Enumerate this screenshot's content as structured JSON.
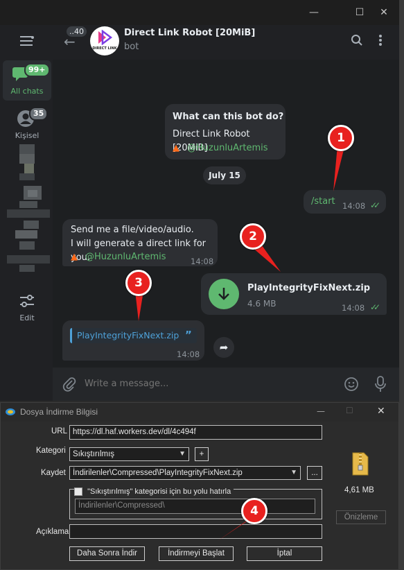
{
  "telegram": {
    "sidebar": {
      "all_chats_badge": "99+",
      "all_chats_label": "All chats",
      "contacts_badge": "35",
      "contacts_label": "Kişisel",
      "edit_label": "Edit"
    },
    "header": {
      "back_count": "..40",
      "logo_text": "DIRECT LINK",
      "title": "Direct Link Robot [20MiB]",
      "subtitle": "bot"
    },
    "messages": {
      "intro_title": "What can this bot do?",
      "intro_body": "Direct Link Robot [20MiB]",
      "intro_mention": "@HuzunluArtemis",
      "date_chip": "July 15",
      "start_text": "/start",
      "start_time": "14:08",
      "reply_line1": "Send me a file/video/audio.",
      "reply_line2": "I will generate a direct link for you.",
      "reply_mention": "@HuzunluArtemis",
      "reply_time": "14:08",
      "file_name": "PlayIntegrityFixNext.zip",
      "file_size": "4.6 MB",
      "file_time": "14:08",
      "link_text": "PlayIntegrityFixNext.zip",
      "link_time": "14:08"
    },
    "composer_placeholder": "Write a message..."
  },
  "markers": [
    "1",
    "2",
    "3",
    "4"
  ],
  "dialog": {
    "title": "Dosya İndirme Bilgisi",
    "url_label": "URL",
    "url_value": "https://dl.haf.workers.dev/dl/4c494f",
    "category_label": "Kategori",
    "category_value": "Sıkıştırılmış",
    "save_label": "Kaydet",
    "save_value": "İndirilenler\\Compressed\\PlayIntegrityFixNext.zip",
    "remember_label": "\"Sıkıştırılmış\" kategorisi için bu yolu hatırla",
    "remember_path": "İndirilenler\\Compressed\\",
    "description_label": "Açıklama",
    "description_value": "",
    "file_size": "4,61 MB",
    "preview_button": "Önizleme",
    "later_button": "Daha Sonra İndir",
    "start_button": "İndirmeyi Başlat",
    "cancel_button": "İptal",
    "browse_button": "...",
    "add_button": "+"
  },
  "colors": {
    "accent_green": "#5fb870",
    "marker_red": "#e8211f",
    "bubble_dark": "#2d2f33",
    "chat_bg": "#1d1f21"
  }
}
